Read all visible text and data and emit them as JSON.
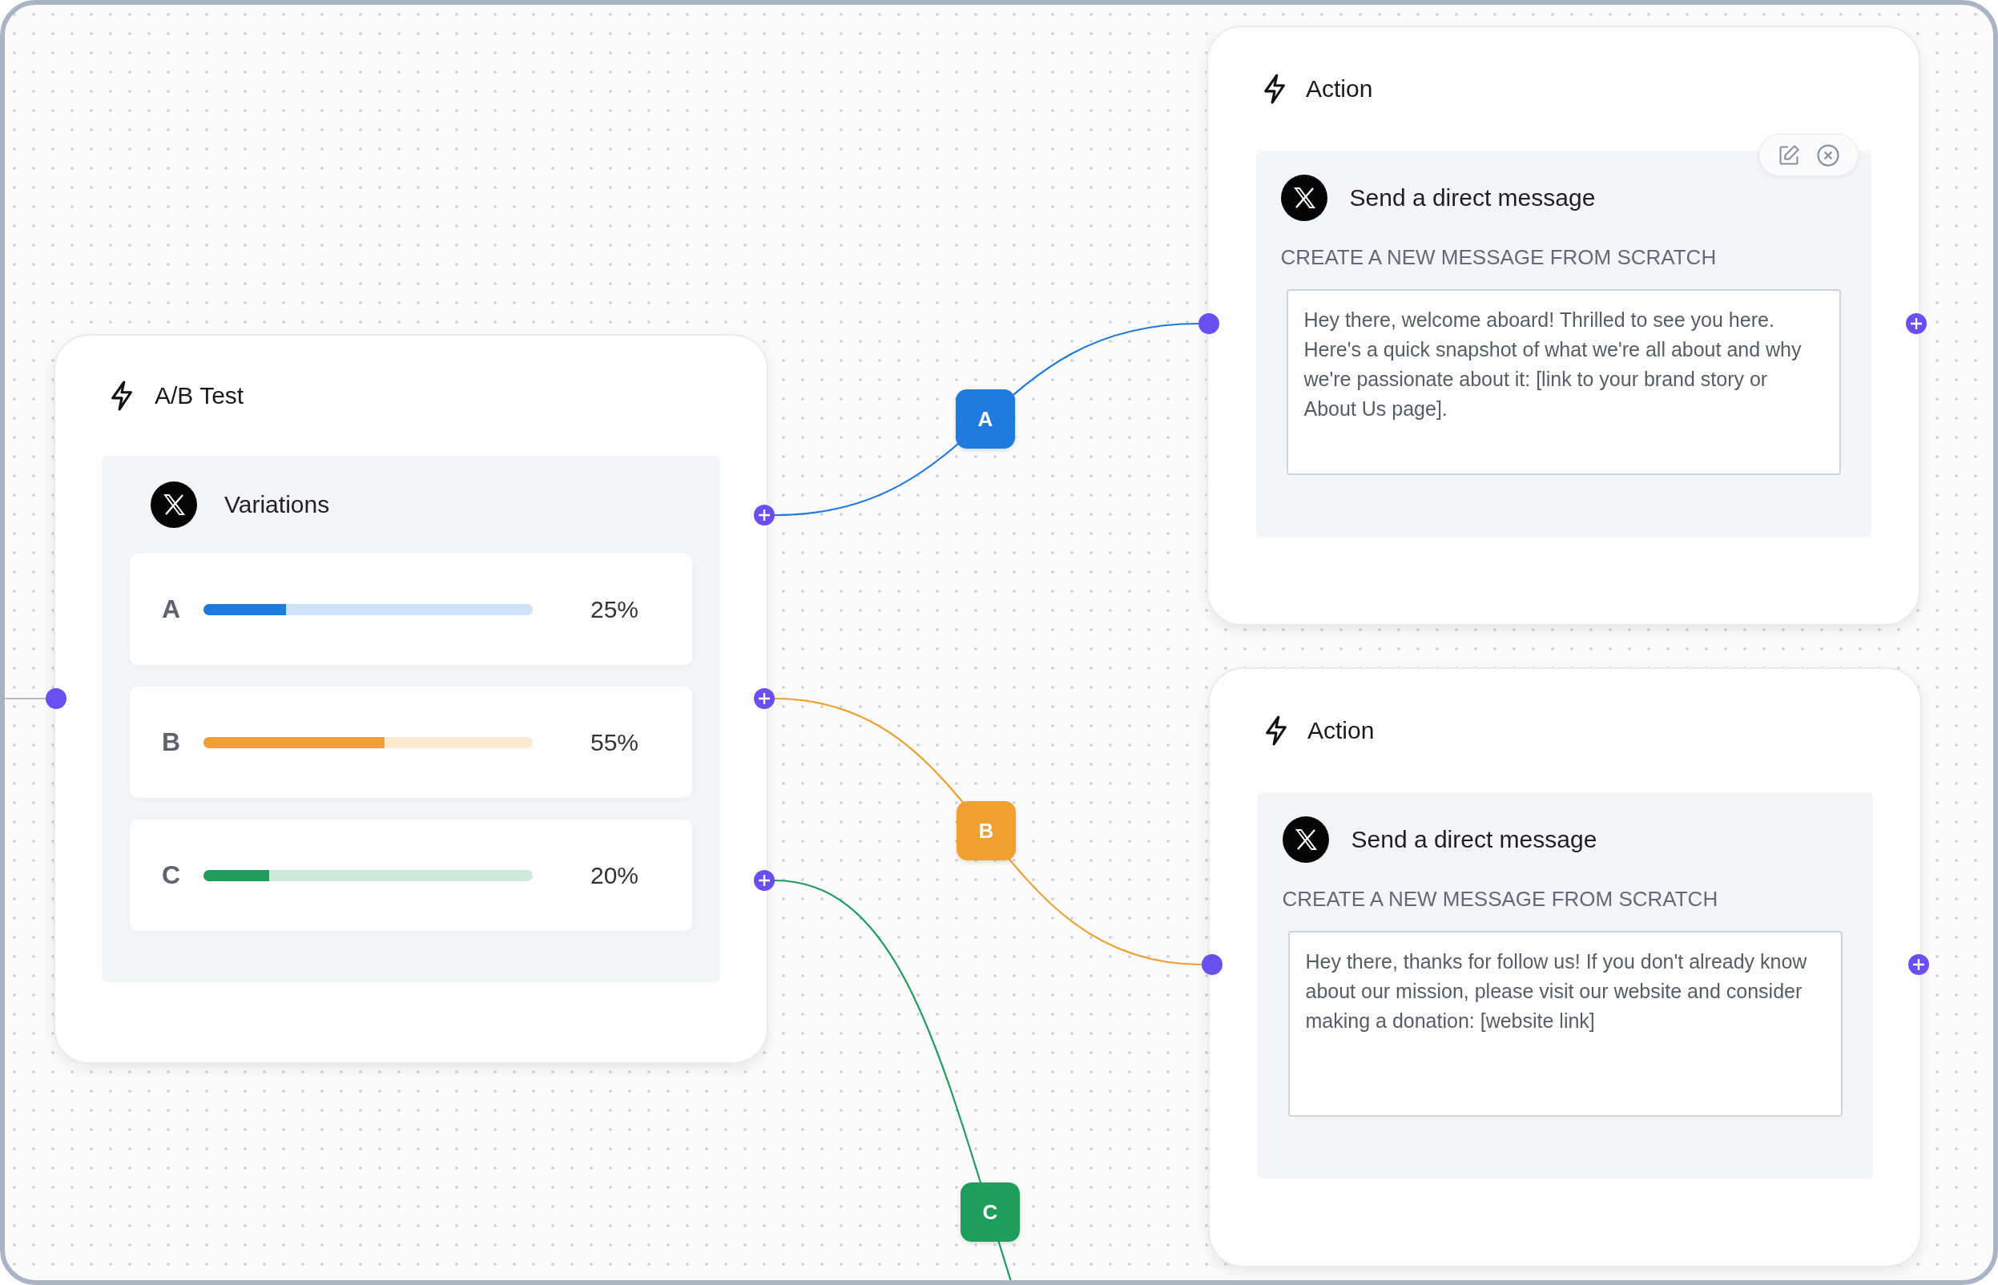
{
  "ab_test": {
    "title": "A/B Test",
    "panel_title": "Variations",
    "variations": [
      {
        "label": "A",
        "level": 0.25,
        "percent": "25%",
        "color": "#1f7ae0"
      },
      {
        "label": "B",
        "level": 0.55,
        "percent": "55%",
        "color": "#f0a030"
      },
      {
        "label": "C",
        "level": 0.2,
        "percent": "20%",
        "color": "#1e9e5a"
      }
    ]
  },
  "connections": [
    {
      "label": "A",
      "color": "#1f7ae0"
    },
    {
      "label": "B",
      "color": "#f0a030"
    },
    {
      "label": "C",
      "color": "#1e9e5a"
    }
  ],
  "actions": [
    {
      "title": "Action",
      "step": "Send a direct message",
      "section": "CREATE A NEW MESSAGE FROM SCRATCH",
      "message": "Hey there, welcome aboard! Thrilled to see you here. Here's a quick snapshot of what we're all about and why we're passionate about it: [link to your brand story or About Us page].",
      "show_tools": true
    },
    {
      "title": "Action",
      "step": "Send a direct message",
      "section": "CREATE A NEW MESSAGE FROM SCRATCH",
      "message": "Hey there, thanks for follow us! If you don't already know about our mission, please visit our website and consider making a donation: [website link]",
      "show_tools": false
    }
  ]
}
